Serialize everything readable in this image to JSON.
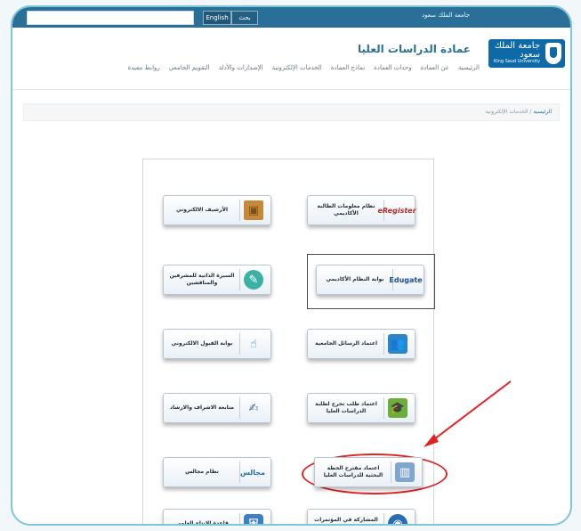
{
  "topbar": {
    "english_label": "English",
    "search_label": "بحث",
    "university_link": "جامعة الملك سعود"
  },
  "logo": {
    "arabic": "جامعة الملك سعود",
    "english": "King Saud University"
  },
  "header": {
    "title": "عمادة الدراسات العليا"
  },
  "nav": {
    "items": [
      "الرئيسية",
      "عن العمادة",
      "وحدات العمادة",
      "نماذج العمادة",
      "الخدمات الإلكترونية",
      "الإصدارات والأدلة",
      "التقويم الجامعي",
      "روابط مفيدة"
    ]
  },
  "breadcrumb": {
    "home": "الرئيسية",
    "sep": "/",
    "current": "الخدمات الإلكترونية"
  },
  "services": [
    {
      "label": "نظام معلومات الطالبة الأكاديمي",
      "icon": "e-register-icon",
      "icon_text": "eRegister"
    },
    {
      "label": "الأرشيف الالكتروني",
      "icon": "archive-box-icon",
      "icon_text": "▣"
    },
    {
      "label": "بوابة النظام الأكاديمي",
      "icon": "edugate-icon",
      "icon_text": "Edugate"
    },
    {
      "label": "السيرة الذاتية للمشرفين والمناقشين",
      "icon": "speech-bubble-icon",
      "icon_text": "✎"
    },
    {
      "label": "اعتماد الرسائل الجامعية",
      "icon": "people-icon",
      "icon_text": "👥"
    },
    {
      "label": "بوابة القبول الالكتروني",
      "icon": "hand-pointer-icon",
      "icon_text": "☝"
    },
    {
      "label": "اعتماد طلب تخرج لطلبة الدراسات العليا",
      "icon": "graduation-cap-icon",
      "icon_text": "🎓"
    },
    {
      "label": "متابعة الاشراف والارشاد",
      "icon": "pen-icon",
      "icon_text": "✍"
    },
    {
      "label": "اعتماد مقترح الخطة البحثية للدراسات العليا",
      "icon": "bar-chart-icon",
      "icon_text": "▥"
    },
    {
      "label": "نظام مجالس",
      "icon": "majales-icon",
      "icon_text": "مجالس"
    },
    {
      "label": "المشاركة في المؤتمرات العلمية",
      "icon": "globe-icon",
      "icon_text": "◉"
    },
    {
      "label": "قاعدة الانتاج العلمي",
      "icon": "shield-icon",
      "icon_text": "⛨"
    }
  ]
}
